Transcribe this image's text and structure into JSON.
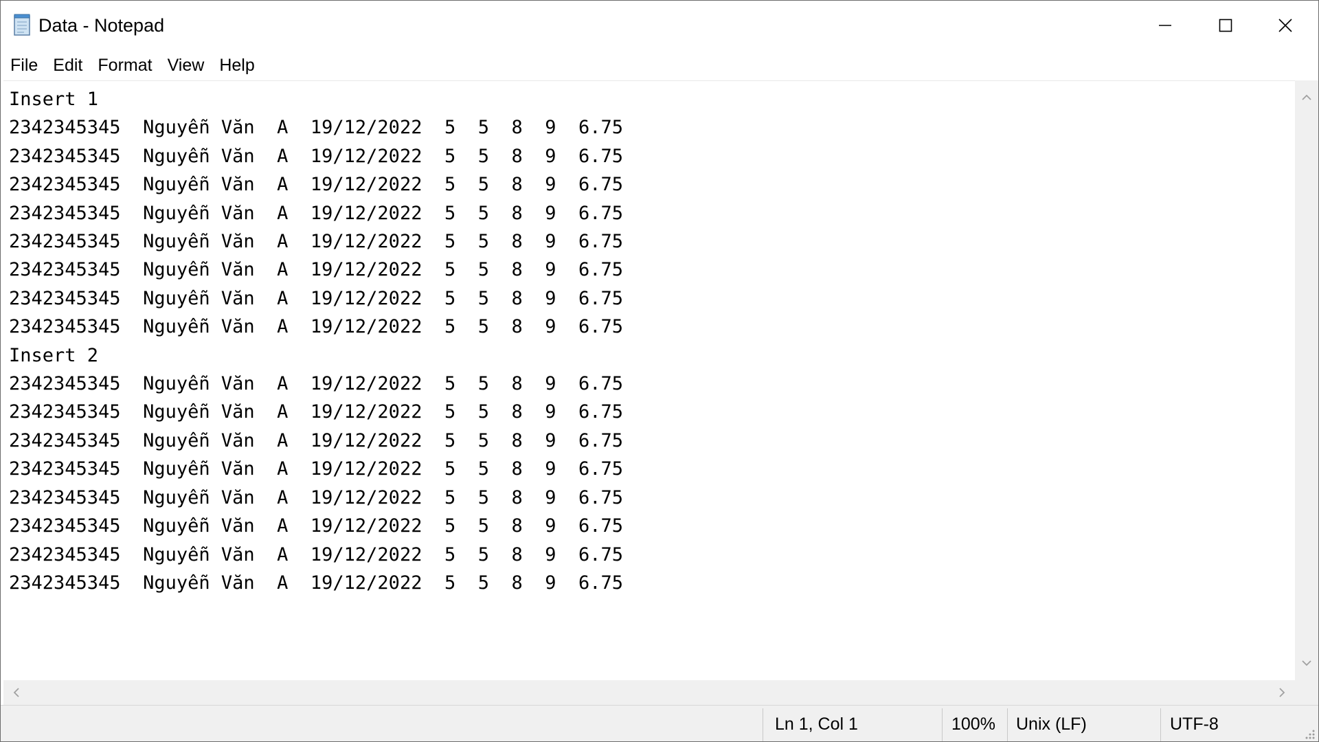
{
  "window": {
    "title": "Data - Notepad",
    "icon": "notepad-icon"
  },
  "controls": {
    "minimize_icon": "minimize-icon",
    "maximize_icon": "maximize-icon",
    "close_icon": "close-icon"
  },
  "menu": {
    "items": [
      {
        "label": "File"
      },
      {
        "label": "Edit"
      },
      {
        "label": "Format"
      },
      {
        "label": "View"
      },
      {
        "label": "Help"
      }
    ]
  },
  "editor": {
    "lines": [
      "Insert 1",
      "2342345345  Nguyễn Văn  A  19/12/2022  5  5  8  9  6.75",
      "2342345345  Nguyễn Văn  A  19/12/2022  5  5  8  9  6.75",
      "2342345345  Nguyễn Văn  A  19/12/2022  5  5  8  9  6.75",
      "2342345345  Nguyễn Văn  A  19/12/2022  5  5  8  9  6.75",
      "2342345345  Nguyễn Văn  A  19/12/2022  5  5  8  9  6.75",
      "2342345345  Nguyễn Văn  A  19/12/2022  5  5  8  9  6.75",
      "2342345345  Nguyễn Văn  A  19/12/2022  5  5  8  9  6.75",
      "2342345345  Nguyễn Văn  A  19/12/2022  5  5  8  9  6.75",
      "Insert 2",
      "2342345345  Nguyễn Văn  A  19/12/2022  5  5  8  9  6.75",
      "2342345345  Nguyễn Văn  A  19/12/2022  5  5  8  9  6.75",
      "2342345345  Nguyễn Văn  A  19/12/2022  5  5  8  9  6.75",
      "2342345345  Nguyễn Văn  A  19/12/2022  5  5  8  9  6.75",
      "2342345345  Nguyễn Văn  A  19/12/2022  5  5  8  9  6.75",
      "2342345345  Nguyễn Văn  A  19/12/2022  5  5  8  9  6.75",
      "2342345345  Nguyễn Văn  A  19/12/2022  5  5  8  9  6.75",
      "2342345345  Nguyễn Văn  A  19/12/2022  5  5  8  9  6.75"
    ]
  },
  "status": {
    "position": "Ln 1, Col 1",
    "zoom": "100%",
    "line_ending": "Unix (LF)",
    "encoding": "UTF-8"
  },
  "colors": {
    "window_border": "#6b6b6b",
    "status_bar_bg": "#f0f0f0",
    "scrollbar_bg": "#f0f0f0",
    "text": "#000000"
  }
}
